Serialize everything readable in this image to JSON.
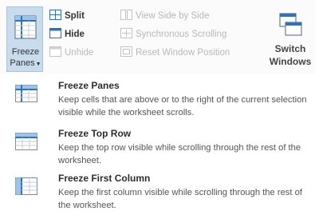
{
  "ribbon": {
    "freeze_panes": {
      "line1": "Freeze",
      "line2": "Panes",
      "icon": "freeze-panes-icon"
    },
    "split": {
      "label": "Split",
      "icon": "split-icon"
    },
    "hide": {
      "label": "Hide",
      "icon": "hide-icon"
    },
    "unhide": {
      "label": "Unhide",
      "icon": "unhide-icon"
    },
    "view_side_by_side": {
      "label": "View Side by Side",
      "icon": "side-by-side-icon"
    },
    "synchronous_scrolling": {
      "label": "Synchronous Scrolling",
      "icon": "sync-scroll-icon"
    },
    "reset_window_position": {
      "label": "Reset Window Position",
      "icon": "reset-window-icon"
    },
    "switch_windows": {
      "line1": "Switch",
      "line2": "Windows",
      "icon": "switch-windows-icon"
    }
  },
  "menu": {
    "items": [
      {
        "title": "Freeze Panes",
        "description": "Keep cells that are above or to the right of the current selection visible while the worksheet scrolls."
      },
      {
        "title": "Freeze Top Row",
        "description": "Keep the top row visible while scrolling through the rest of the worksheet."
      },
      {
        "title": "Freeze First Column",
        "description": "Keep the first column visible while scrolling through the rest of the worksheet."
      }
    ]
  },
  "colors": {
    "accent": "#2e74b5",
    "selected_bg": "#c8dcee",
    "disabled_text": "#b8b8b8"
  }
}
